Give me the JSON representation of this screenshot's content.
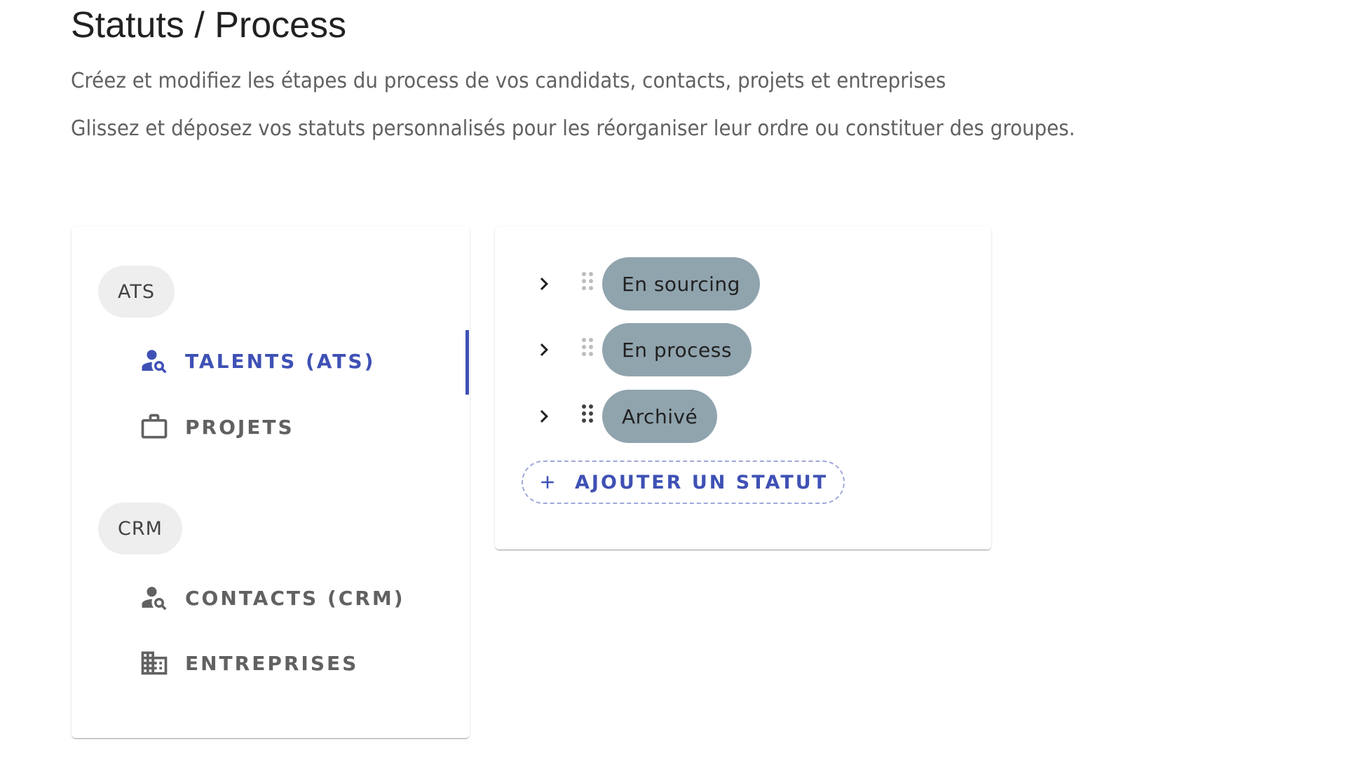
{
  "header": {
    "title": "Statuts / Process",
    "description_1": "Créez et modifiez les étapes du process de vos candidats, contacts, projets et entreprises",
    "description_2": "Glissez et déposez vos statuts personnalisés pour les réorganiser leur ordre ou constituer des groupes."
  },
  "sidebar": {
    "groups": [
      {
        "label": "ATS",
        "items": [
          {
            "label": "TALENTS (ATS)",
            "icon": "person-search-icon",
            "active": true
          },
          {
            "label": "PROJETS",
            "icon": "briefcase-icon",
            "active": false
          }
        ]
      },
      {
        "label": "CRM",
        "items": [
          {
            "label": "CONTACTS (CRM)",
            "icon": "person-search-icon",
            "active": false
          },
          {
            "label": "ENTREPRISES",
            "icon": "building-icon",
            "active": false
          }
        ]
      }
    ]
  },
  "statuses": {
    "items": [
      {
        "label": "En sourcing"
      },
      {
        "label": "En process"
      },
      {
        "label": "Archivé"
      }
    ],
    "add_label": "AJOUTER UN STATUT"
  },
  "colors": {
    "accent": "#3f51b5",
    "chip": "#90a4ae",
    "group_chip": "#eeeeee",
    "text_secondary": "#616161"
  }
}
